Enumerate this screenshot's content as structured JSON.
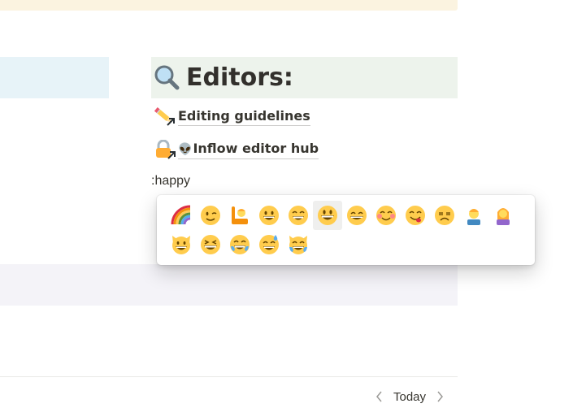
{
  "callout": {
    "heading": "Editors:",
    "heading_icon": "magnifying-glass-icon"
  },
  "links": [
    {
      "icon": "pencil-icon",
      "label": "Editing guidelines",
      "prefix": ""
    },
    {
      "icon": "lock-icon",
      "label": "Inflow editor hub",
      "prefix": "👽"
    }
  ],
  "editor": {
    "typed_text": ":happy"
  },
  "emoji_picker": {
    "rows": [
      [
        "rainbow",
        "winking-face",
        "person-raising-hand",
        "grinning-face",
        "beaming-face",
        "grinning-face-big-eyes",
        "grinning-squinting-smile",
        "smiling-face-blush",
        "face-savoring-food",
        "unamused-face",
        "man-standing",
        "woman-standing"
      ],
      [
        "grinning-cat",
        "squinting-face",
        "tears-of-joy",
        "grinning-sweat",
        "cat-tears-of-joy"
      ]
    ],
    "selected": "grinning-face-big-eyes"
  },
  "date_nav": {
    "prev_icon": "chevron-left-icon",
    "today_label": "Today",
    "next_icon": "chevron-right-icon"
  }
}
